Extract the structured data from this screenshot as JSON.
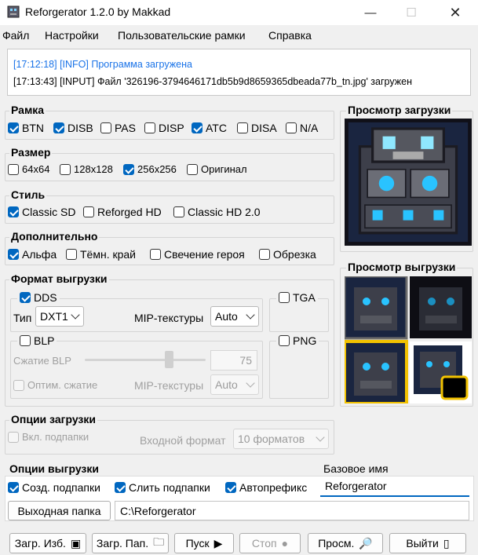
{
  "window": {
    "title": "Reforgerator 1.2.0 by Makkad"
  },
  "menu": [
    "Файл",
    "Настройки",
    "Пользовательские рамки",
    "Справка"
  ],
  "log": [
    {
      "text": "[17:12:18] [INFO] Программа загружена",
      "color": "#1a73e8"
    },
    {
      "text": "[17:13:43] [INPUT] Файл '326196-3794646171db5b9d8659365dbeada77b_tn.jpg' загружен",
      "color": "#000000"
    }
  ],
  "frame": {
    "title": "Рамка",
    "options": [
      {
        "label": "BTN",
        "checked": true
      },
      {
        "label": "DISB",
        "checked": true
      },
      {
        "label": "PAS",
        "checked": false
      },
      {
        "label": "DISP",
        "checked": false
      },
      {
        "label": "ATC",
        "checked": true
      },
      {
        "label": "DISA",
        "checked": false
      },
      {
        "label": "N/A",
        "checked": false
      }
    ]
  },
  "size": {
    "title": "Размер",
    "options": [
      {
        "label": "64x64",
        "checked": false
      },
      {
        "label": "128x128",
        "checked": false
      },
      {
        "label": "256x256",
        "checked": true
      },
      {
        "label": "Оригинал",
        "checked": false
      }
    ]
  },
  "style": {
    "title": "Стиль",
    "options": [
      {
        "label": "Classic SD",
        "checked": true
      },
      {
        "label": "Reforged HD",
        "checked": false
      },
      {
        "label": "Classic HD 2.0",
        "checked": false
      }
    ]
  },
  "extra": {
    "title": "Дополнительно",
    "options": [
      {
        "label": "Альфа",
        "checked": true
      },
      {
        "label": "Тёмн. край",
        "checked": false
      },
      {
        "label": "Свечение героя",
        "checked": false
      },
      {
        "label": "Обрезка",
        "checked": false
      }
    ]
  },
  "export_format": {
    "title": "Формат выгрузки",
    "dds": {
      "label": "DDS",
      "checked": true,
      "type_label": "Тип",
      "type_value": "DXT1",
      "mip_label": "MIP-текстуры",
      "mip_value": "Auto"
    },
    "blp": {
      "label": "BLP",
      "checked": false,
      "compression_label": "Сжатие BLP",
      "compression_value": "75",
      "optimize_label": "Оптим. сжатие",
      "mip_label": "MIP-текстуры",
      "mip_value": "Auto"
    },
    "tga": {
      "label": "TGA",
      "checked": false
    },
    "png": {
      "label": "PNG",
      "checked": false
    },
    "blp_slider_fraction": 0.75
  },
  "preview_load": {
    "title": "Просмотр загрузки"
  },
  "preview_export": {
    "title": "Просмотр выгрузки"
  },
  "load_options": {
    "title": "Опции загрузки",
    "subfolders_label": "Вкл. подпапки",
    "input_format_label": "Входной формат",
    "input_format_value": "10 форматов"
  },
  "export_options": {
    "title": "Опции выгрузки",
    "create_subfolders": "Созд. подпапки",
    "merge_subfolders": "Слить подпапки",
    "autoprefix": "Автопрефикс",
    "base_name_label": "Базовое имя",
    "base_name_value": "Reforgerator",
    "output_folder_button": "Выходная папка",
    "output_folder_value": "C:\\Reforgerator"
  },
  "toolbar": {
    "load_image": "Загр. Изб.",
    "load_folder": "Загр. Пап.",
    "start": "Пуск",
    "stop": "Стоп",
    "view": "Просм.",
    "exit": "Выйти"
  },
  "colors": {
    "accent": "#0067c0",
    "log_info": "#1a73e8",
    "preview_highlight": "#f2c200"
  }
}
